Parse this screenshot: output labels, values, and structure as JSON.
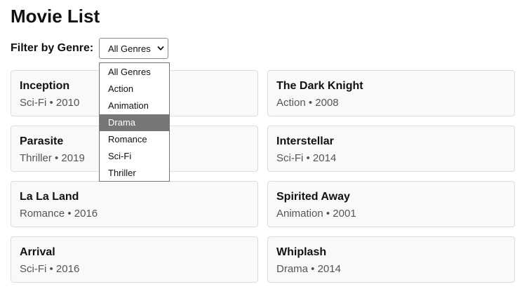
{
  "page": {
    "title": "Movie List"
  },
  "filter": {
    "label": "Filter by Genre:",
    "selected": "All Genres",
    "highlighted": "Drama",
    "options": [
      "All Genres",
      "Action",
      "Animation",
      "Drama",
      "Romance",
      "Sci-Fi",
      "Thriller"
    ]
  },
  "movies": [
    {
      "title": "Inception",
      "meta": "Sci-Fi • 2010"
    },
    {
      "title": "The Dark Knight",
      "meta": "Action • 2008"
    },
    {
      "title": "Parasite",
      "meta": "Thriller • 2019"
    },
    {
      "title": "Interstellar",
      "meta": "Sci-Fi • 2014"
    },
    {
      "title": "La La Land",
      "meta": "Romance • 2016"
    },
    {
      "title": "Spirited Away",
      "meta": "Animation • 2001"
    },
    {
      "title": "Arrival",
      "meta": "Sci-Fi • 2016"
    },
    {
      "title": "Whiplash",
      "meta": "Drama • 2014"
    }
  ],
  "colors": {
    "card_background": "#f9f9f9",
    "card_border": "#dddddd",
    "highlight": "#767676",
    "meta_text": "#555555"
  }
}
